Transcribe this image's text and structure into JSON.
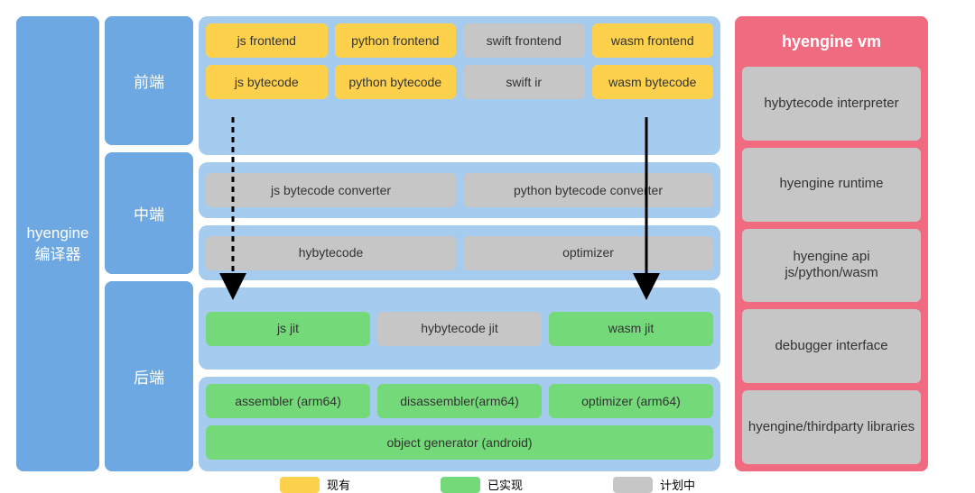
{
  "compiler": {
    "title_l1": "hyengine",
    "title_l2": "编译器"
  },
  "stages": {
    "frontend": "前端",
    "middle": "中端",
    "backend": "后端"
  },
  "frontend": {
    "row1": [
      {
        "label": "js frontend",
        "cls": "yellow"
      },
      {
        "label": "python frontend",
        "cls": "yellow"
      },
      {
        "label": "swift frontend",
        "cls": "grey"
      },
      {
        "label": "wasm frontend",
        "cls": "yellow"
      }
    ],
    "row2": [
      {
        "label": "js bytecode",
        "cls": "yellow"
      },
      {
        "label": "python bytecode",
        "cls": "yellow"
      },
      {
        "label": "swift ir",
        "cls": "grey"
      },
      {
        "label": "wasm bytecode",
        "cls": "yellow"
      }
    ]
  },
  "middle": {
    "row1": [
      {
        "label": "js bytecode converter",
        "cls": "grey"
      },
      {
        "label": "python bytecode converter",
        "cls": "grey"
      }
    ],
    "row2": [
      {
        "label": "hybytecode",
        "cls": "grey"
      },
      {
        "label": "optimizer",
        "cls": "grey"
      }
    ]
  },
  "backend": {
    "row1": [
      {
        "label": "js jit",
        "cls": "green"
      },
      {
        "label": "hybytecode jit",
        "cls": "grey"
      },
      {
        "label": "wasm jit",
        "cls": "green"
      }
    ],
    "row2": [
      {
        "label": "assembler (arm64)",
        "cls": "green"
      },
      {
        "label": "disassembler(arm64)",
        "cls": "green"
      },
      {
        "label": "optimizer (arm64)",
        "cls": "green"
      }
    ],
    "row3": [
      {
        "label": "object generator (android)",
        "cls": "green"
      }
    ]
  },
  "vm": {
    "title": "hyengine vm",
    "items": [
      "hybytecode interpreter",
      "hyengine runtime",
      "hyengine api js/python/wasm",
      "debugger interface",
      "hyengine/thirdparty libraries"
    ]
  },
  "legend": [
    {
      "label": "现有",
      "cls": "yellow"
    },
    {
      "label": "已实现",
      "cls": "green"
    },
    {
      "label": "计划中",
      "cls": "grey"
    }
  ]
}
